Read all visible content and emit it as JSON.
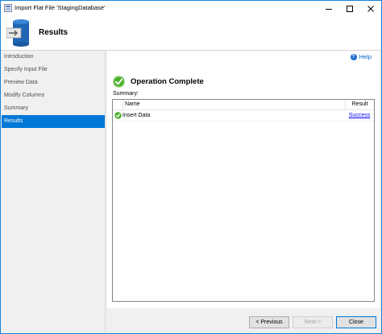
{
  "window": {
    "title": "Import Flat File 'StagingDatabase'"
  },
  "header": {
    "title": "Results"
  },
  "sidebar": {
    "items": [
      {
        "label": "Introduction",
        "active": false
      },
      {
        "label": "Specify Input File",
        "active": false
      },
      {
        "label": "Preview Data",
        "active": false
      },
      {
        "label": "Modify Columns",
        "active": false
      },
      {
        "label": "Summary",
        "active": false
      },
      {
        "label": "Results",
        "active": true
      }
    ]
  },
  "help": {
    "label": "Help"
  },
  "status": {
    "text": "Operation Complete"
  },
  "summary": {
    "label": "Summary:",
    "columns": {
      "name": "Name",
      "result": "Result"
    },
    "rows": [
      {
        "name": "Insert Data",
        "result": "Success"
      }
    ]
  },
  "footer": {
    "previous": "< Previous",
    "next": "Next >",
    "close": "Close"
  },
  "colors": {
    "accent": "#0078d7",
    "success": "#4caf2c",
    "link": "#0000ee"
  }
}
